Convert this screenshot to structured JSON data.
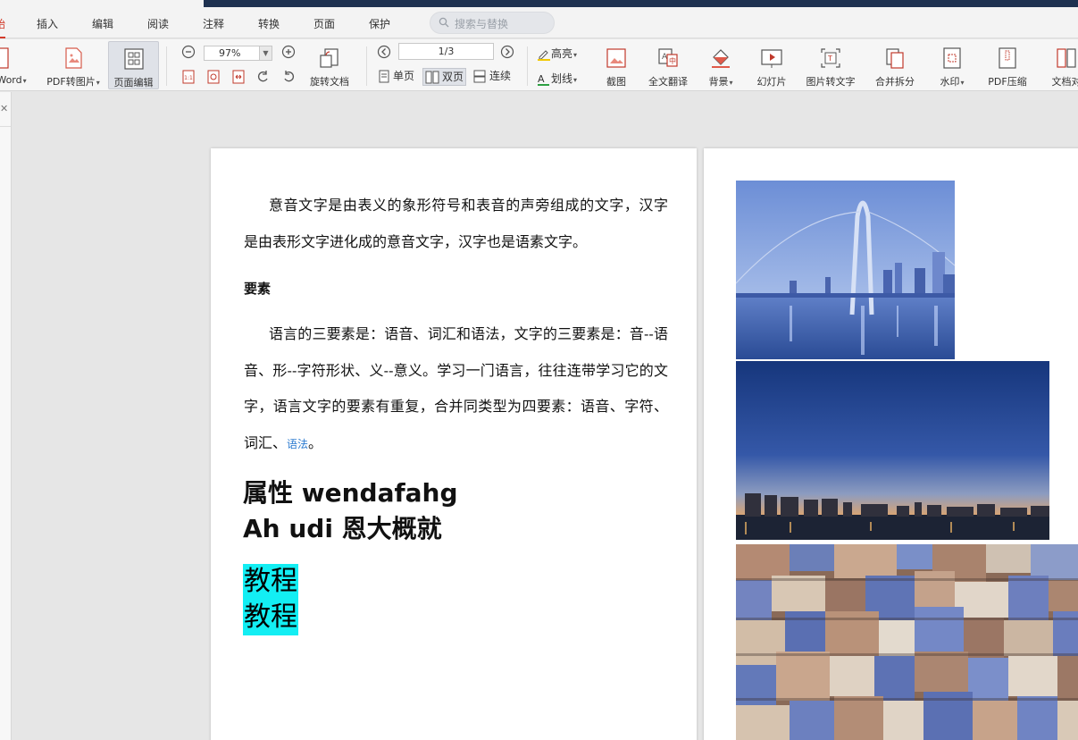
{
  "menu": {
    "items": [
      "插入",
      "编辑",
      "阅读",
      "注释",
      "转换",
      "页面",
      "保护"
    ],
    "active_partial": "始"
  },
  "search": {
    "placeholder": "搜索与替换"
  },
  "toolbar": {
    "word_label": "Word",
    "pdf_to_image": "PDF转图片",
    "page_edit": "页面编辑",
    "zoom": "97%",
    "rotate_doc": "旋转文档",
    "page_indicator": "1/3",
    "single_page": "单页",
    "double_page": "双页",
    "continuous": "连续",
    "highlight": "高亮",
    "underline": "划线",
    "screenshot": "截图",
    "full_translate": "全文翻译",
    "background": "背景",
    "slideshow": "幻灯片",
    "image_to_text": "图片转文字",
    "merge_split": "合并拆分",
    "watermark": "水印",
    "pdf_compress": "PDF压缩",
    "doc_compare": "文档对"
  },
  "document": {
    "para1": "意音文字是由表义的象形符号和表音的声旁组成的文字，汉字是由表形文字进化成的意音文字，汉字也是语素文字。",
    "heading": "要素",
    "para2_main": "语言的三要素是：语音、词汇和语法，文字的三要素是：音--语音、形--字符形状、义--意义。学习一门语言，往往连带学习它的文字，语言文字的要素有重复，合并同类型为四要素：语音、字符、词汇、",
    "para2_link": "语法",
    "para2_end": "。",
    "big1": "属性 wendafahg",
    "big2": "Ah udi 恩大概就",
    "highlight1": "教程",
    "highlight2": "教程"
  },
  "colors": {
    "accent": "#d23a2a",
    "highlight": "#13eef3",
    "topbar": "#1e3150"
  }
}
